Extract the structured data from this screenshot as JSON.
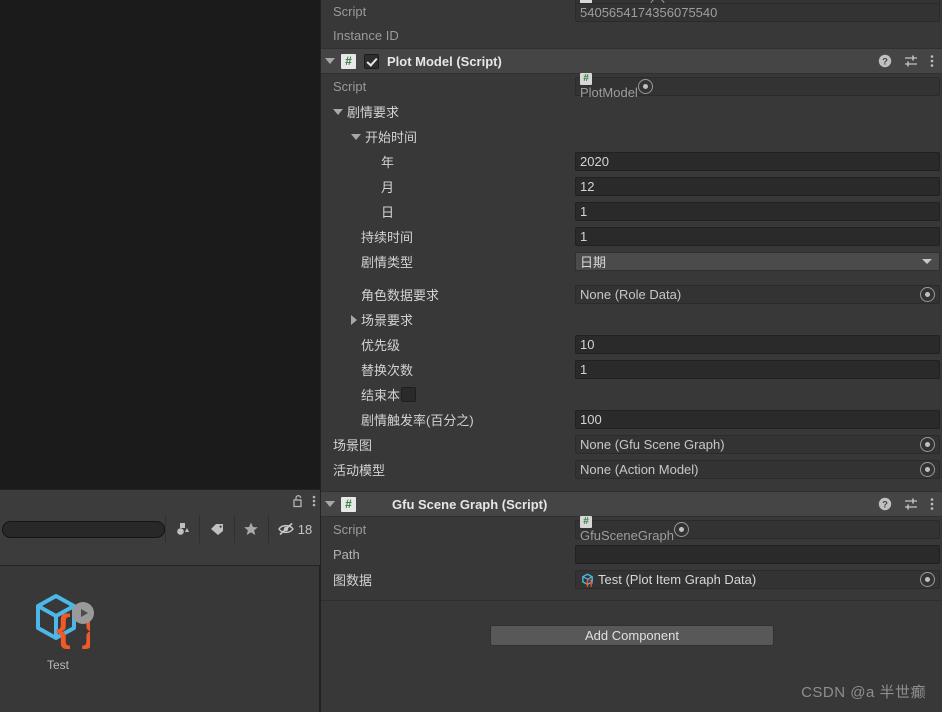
{
  "project_panel": {
    "title_icons": {
      "lock": "unlock-icon",
      "menu": "kebab-menu-icon"
    },
    "search": {
      "value": "",
      "placeholder": ""
    },
    "filters": [
      {
        "name": "filter-by-type",
        "icon": "object-type-icon"
      },
      {
        "name": "filter-by-label",
        "icon": "label-tag-icon"
      },
      {
        "name": "filter-by-favorite",
        "icon": "star-icon"
      }
    ],
    "hidden_items": {
      "icon": "eye-crossed-icon",
      "count": "18"
    },
    "assets": [
      {
        "label": "Test",
        "icon": "graph-asset-icon",
        "badge": "play-badge-icon"
      }
    ]
  },
  "inspector": {
    "top_rows": [
      {
        "label": "Script",
        "value": "GfuInstance",
        "type": "object-readonly",
        "icon": "cs-script-icon"
      },
      {
        "label": "Instance ID",
        "value": "5405654174356075540",
        "type": "readonly"
      }
    ],
    "components": [
      {
        "title": "Plot Model (Script)",
        "icon": "cs-script-icon",
        "enabled": true,
        "header_icons": [
          "help-icon",
          "preset-icon",
          "kebab-menu-icon"
        ],
        "rows": [
          {
            "label": "Script",
            "value": "PlotModel",
            "type": "object-readonly",
            "icon": "cs-script-icon",
            "indent": 0
          },
          {
            "label": "剧情要求",
            "type": "foldout-open",
            "indent": 0
          },
          {
            "label": "开始时间",
            "type": "foldout-open",
            "indent": 1
          },
          {
            "label": "年",
            "value": "2020",
            "type": "input",
            "indent": 3
          },
          {
            "label": "月",
            "value": "12",
            "type": "input",
            "indent": 3
          },
          {
            "label": "日",
            "value": "1",
            "type": "input",
            "indent": 3
          },
          {
            "label": "持续时间",
            "value": "1",
            "type": "input",
            "indent": 2
          },
          {
            "label": "剧情类型",
            "value": "日期",
            "type": "dropdown",
            "indent": 2
          },
          {
            "label": "角色数据要求",
            "value": "None (Role Data)",
            "type": "object",
            "indent": 2
          },
          {
            "label": "场景要求",
            "type": "foldout-closed",
            "indent": 1
          },
          {
            "label": "优先级",
            "value": "10",
            "type": "input",
            "indent": 2
          },
          {
            "label": "替换次数",
            "value": "1",
            "type": "input",
            "indent": 2
          },
          {
            "label": "结束本日",
            "value": false,
            "type": "checkbox",
            "indent": 2
          },
          {
            "label": "剧情触发率(百分之)",
            "value": "100",
            "type": "input",
            "indent": 2
          },
          {
            "label": "场景图",
            "value": "None (Gfu Scene Graph)",
            "type": "object",
            "indent": 0
          },
          {
            "label": "活动模型",
            "value": "None (Action Model)",
            "type": "object",
            "indent": 0
          }
        ]
      },
      {
        "title": "Gfu Scene Graph (Script)",
        "icon": "cs-script-icon",
        "enabled": null,
        "header_icons": [
          "help-icon",
          "preset-icon",
          "kebab-menu-icon"
        ],
        "rows": [
          {
            "label": "Script",
            "value": "GfuSceneGraph",
            "type": "object-readonly",
            "icon": "cs-script-icon",
            "indent": 0
          },
          {
            "label": "Path",
            "value": "",
            "type": "input",
            "indent": 0
          },
          {
            "label": "图数据",
            "value": "Test (Plot Item Graph Data)",
            "type": "object-asset",
            "icon": "graph-asset-icon",
            "indent": 0
          }
        ]
      }
    ],
    "add_component_label": "Add Component"
  },
  "watermark": "CSDN @a 半世癫",
  "colors": {
    "background": "#383838",
    "panel_dark": "#1b1b1b",
    "component_header": "#454545",
    "input_bg": "#2a2a2a",
    "dropdown_bg": "#4b4b4b",
    "accent_cube": "#4bb8e8",
    "accent_braces": "#f05a28",
    "script_green": "#2f7d3a"
  }
}
